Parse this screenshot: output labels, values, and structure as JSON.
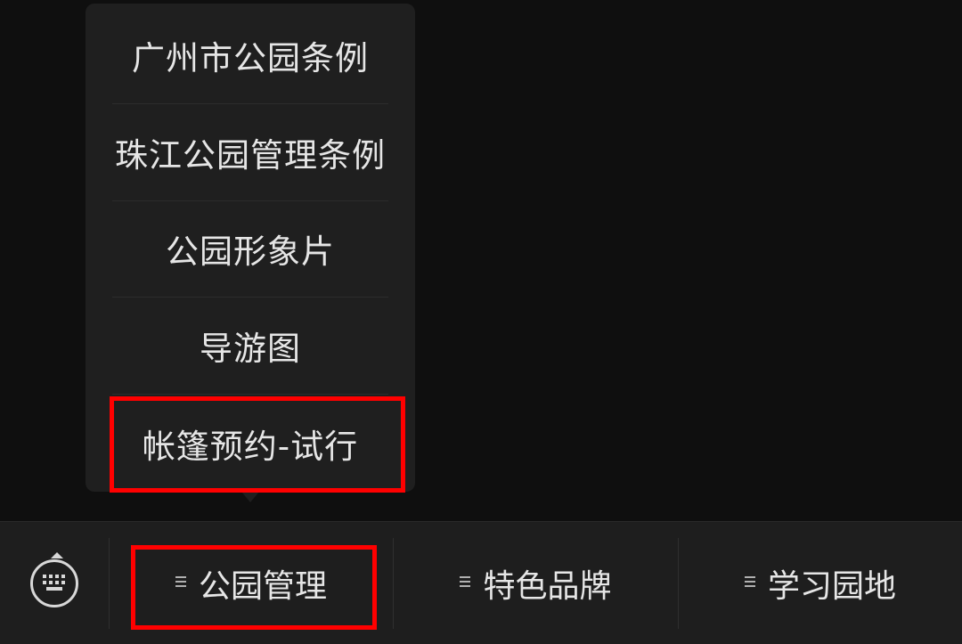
{
  "popup_menu": {
    "items": [
      {
        "label": "广州市公园条例"
      },
      {
        "label": "珠江公园管理条例"
      },
      {
        "label": "公园形象片"
      },
      {
        "label": "导游图"
      },
      {
        "label": "帐篷预约-试行"
      }
    ]
  },
  "bottom_bar": {
    "keyboard_icon": "keyboard-icon",
    "menu_icon": "menu-lines-icon",
    "tabs": [
      {
        "label": "公园管理"
      },
      {
        "label": "特色品牌"
      },
      {
        "label": "学习园地"
      }
    ]
  },
  "annotations": {
    "highlight_color": "#ff0000"
  }
}
